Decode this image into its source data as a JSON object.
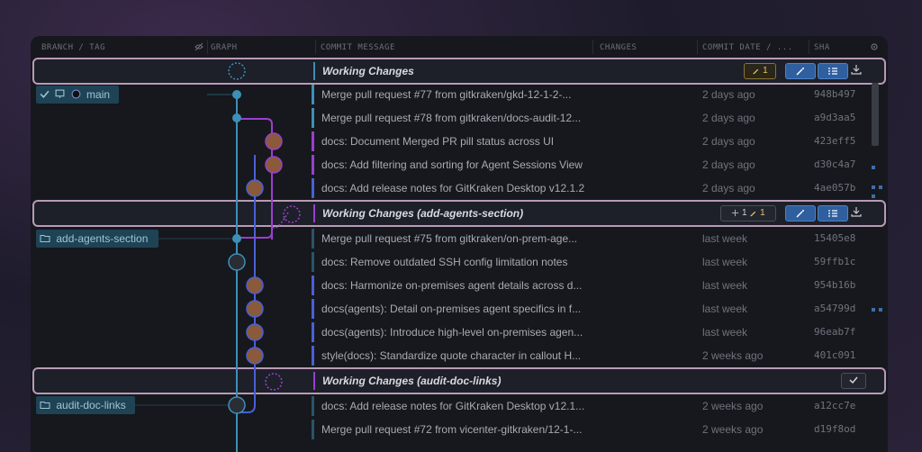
{
  "columns": {
    "branch_tag": "BRANCH / TAG",
    "graph": "GRAPH",
    "commit_message": "COMMIT MESSAGE",
    "changes": "CHANGES",
    "commit_date": "COMMIT DATE / ...",
    "sha": "SHA"
  },
  "branches": {
    "main": "main",
    "add_agents": "add-agents-section",
    "audit": "audit-doc-links"
  },
  "working_changes": {
    "wc1": {
      "title": "Working Changes",
      "edit_count": "1"
    },
    "wc2": {
      "title": "Working Changes (add-agents-section)",
      "add_count": "1",
      "edit_count": "1"
    },
    "wc3": {
      "title": "Working Changes (audit-doc-links)"
    }
  },
  "commits": [
    {
      "message": "Merge pull request #77 from gitkraken/gkd-12-1-2-...",
      "date": "2 days ago",
      "sha": "948b497"
    },
    {
      "message": "Merge pull request #78 from gitkraken/docs-audit-12...",
      "date": "2 days ago",
      "sha": "a9d3aa5"
    },
    {
      "message": "docs: Document Merged PR pill status across UI",
      "date": "2 days ago",
      "sha": "423eff5"
    },
    {
      "message": "docs: Add filtering and sorting for Agent Sessions View",
      "date": "2 days ago",
      "sha": "d30c4a7"
    },
    {
      "message": "docs: Add release notes for GitKraken Desktop v12.1.2",
      "date": "2 days ago",
      "sha": "4ae057b"
    },
    {
      "message": "Merge pull request #75 from gitkraken/on-prem-age...",
      "date": "last week",
      "sha": "15405e8"
    },
    {
      "message": "docs: Remove outdated SSH config limitation notes",
      "date": "last week",
      "sha": "59ffb1c"
    },
    {
      "message": "docs: Harmonize on-premises agent details across d...",
      "date": "last week",
      "sha": "954b16b"
    },
    {
      "message": "docs(agents): Detail on-premises agent specifics in f...",
      "date": "last week",
      "sha": "a54799d"
    },
    {
      "message": "docs(agents): Introduce high-level on-premises agen...",
      "date": "last week",
      "sha": "96eab7f"
    },
    {
      "message": "style(docs): Standardize quote character in callout H...",
      "date": "2 weeks ago",
      "sha": "401c091"
    },
    {
      "message": "docs: Add release notes for GitKraken Desktop v12.1...",
      "date": "2 weeks ago",
      "sha": "a12cc7e"
    },
    {
      "message": "Merge pull request #72 from vicenter-gitkraken/12-1-...",
      "date": "2 weeks ago",
      "sha": "d19f8od"
    }
  ],
  "colors": {
    "lane_blue": "#3d8fb8",
    "lane_purple": "#9b3fd0",
    "lane_indigo": "#4b5fd6",
    "highlight_border": "#b99ab6",
    "button_blue": "#2f5f9e"
  },
  "icons": [
    "checkmark-icon",
    "monitor-icon",
    "repo-icon",
    "branch-folder-icon",
    "ai-wand-icon",
    "checklist-icon",
    "download-icon",
    "pencil-icon",
    "plus-icon",
    "settings-gear-icon",
    "hide-icon"
  ]
}
